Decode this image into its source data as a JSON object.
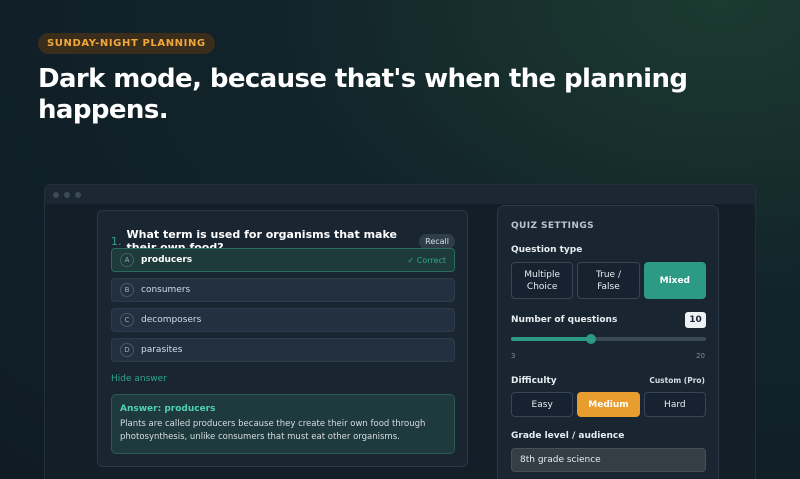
{
  "badge": "SUNDAY-NIGHT PLANNING",
  "headline": "Dark mode, because that's when the planning happens.",
  "quiz": {
    "question_number": "1.",
    "question": "What term is used for organisms that make their own food?",
    "recall_label": "Recall",
    "options": [
      {
        "letter": "A",
        "text": "producers",
        "correct": true
      },
      {
        "letter": "B",
        "text": "consumers"
      },
      {
        "letter": "C",
        "text": "decomposers"
      },
      {
        "letter": "D",
        "text": "parasites"
      }
    ],
    "correct_label": "✓ Correct",
    "hide_answer": "Hide answer",
    "answer_title": "Answer: producers",
    "answer_body": "Plants are called producers because they create their own food through photosynthesis, unlike consumers that must eat other organisms."
  },
  "settings": {
    "title": "QUIZ SETTINGS",
    "question_type_label": "Question type",
    "question_types": [
      "Multiple Choice",
      "True / False",
      "Mixed"
    ],
    "question_type_selected": "Mixed",
    "num_questions_label": "Number of questions",
    "num_questions": "10",
    "slider": {
      "min": "3",
      "max": "20",
      "value": 10
    },
    "difficulty_label": "Difficulty",
    "custom_pro": "Custom (Pro)",
    "difficulties": [
      "Easy",
      "Medium",
      "Hard"
    ],
    "difficulty_selected": "Medium",
    "grade_label": "Grade level / audience",
    "grade_value": "8th grade science"
  },
  "colors": {
    "accent_teal": "#2d9a85",
    "accent_amber": "#e99d2f"
  }
}
